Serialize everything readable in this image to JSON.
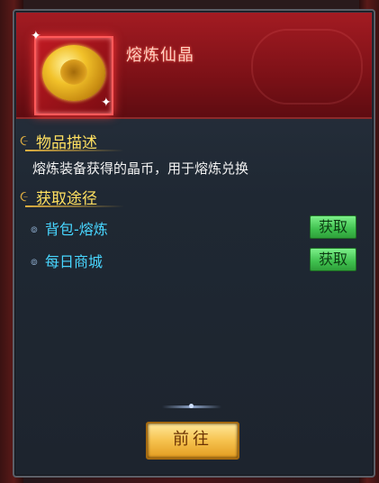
{
  "item": {
    "name": "熔炼仙晶",
    "icon": "gold-coin-icon"
  },
  "description": {
    "heading": "物品描述",
    "text": "熔炼装备获得的晶币，用于熔炼兑换"
  },
  "sources": {
    "heading": "获取途径",
    "items": [
      {
        "label": "背包-熔炼",
        "button": "获取"
      },
      {
        "label": "每日商城",
        "button": "获取"
      }
    ]
  },
  "footer": {
    "go_button": "前往"
  },
  "colors": {
    "header": "#8c1218",
    "heading_text": "#ffe060",
    "source_text": "#48d6ff",
    "get_button": "#4fd05e",
    "go_button": "#f3b83c"
  }
}
